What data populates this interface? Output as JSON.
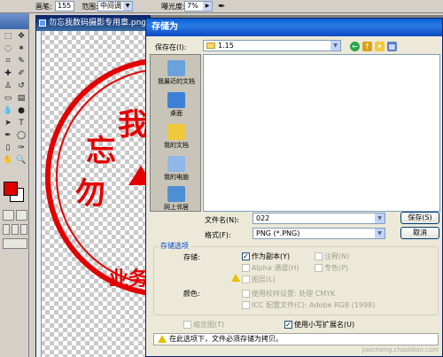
{
  "optionsbar": {
    "brush_label": "画笔:",
    "brush_size": "155",
    "range_label": "范围:",
    "range_value": "中间调",
    "exposure_label": "曝光度:",
    "exposure_value": "7%"
  },
  "toolbox": {
    "foreground_color": "#e00000",
    "background_color": "#ffffff"
  },
  "document": {
    "title": "勿忘我数码摄影专用章.png",
    "seal_chars": [
      "勿",
      "忘",
      "我"
    ],
    "seal_bottom_text": "业务"
  },
  "dialog": {
    "title": "存储为",
    "save_in_label": "保存在(I):",
    "save_in_value": "1.15",
    "places": [
      {
        "label": "我最近的文档",
        "icon": "recent-docs-icon"
      },
      {
        "label": "桌面",
        "icon": "desktop-icon"
      },
      {
        "label": "我的文档",
        "icon": "my-documents-icon"
      },
      {
        "label": "我的电脑",
        "icon": "my-computer-icon"
      },
      {
        "label": "网上邻居",
        "icon": "network-icon"
      }
    ],
    "filename_label": "文件名(N):",
    "filename_value": "022",
    "format_label": "格式(F):",
    "format_value": "PNG (*.PNG)",
    "save_button": "保存(S)",
    "cancel_button": "取消",
    "options_title": "存储选项",
    "storage_label": "存储:",
    "as_copy": "作为副本(Y)",
    "annotations": "注释(N)",
    "alpha": "Alpha 通道(H)",
    "spot": "专色(P)",
    "layers": "图层(L)",
    "color_label": "颜色:",
    "use_proof": "使用校样设置: 处理 CMYK",
    "icc": "ICC 配置文件(C): Adobe RGB (1998)",
    "thumbnail": "缩览图(T)",
    "lowercase_ext": "使用小写扩展名(U)",
    "warning_text": "在此选项下，文件必须存储为拷贝。"
  },
  "watermark": "jiaocheng.chazidian.com"
}
